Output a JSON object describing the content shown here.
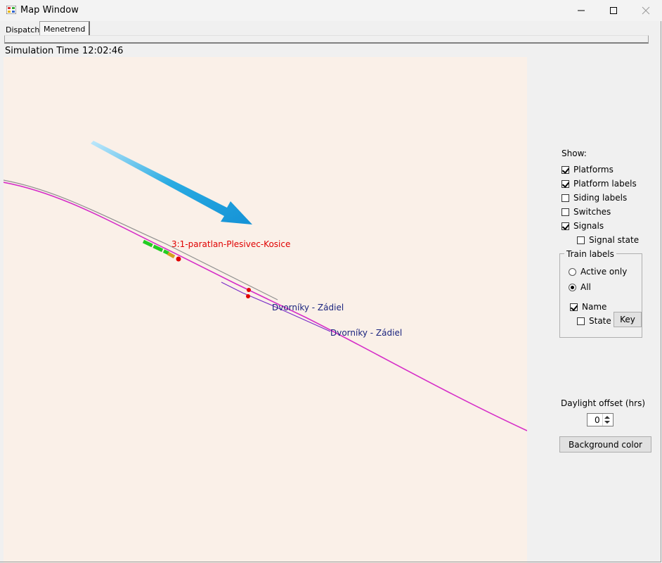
{
  "window": {
    "title": "Map Window",
    "icon": "app-window-icon",
    "controls": [
      "minimize-icon",
      "maximize-icon",
      "close-icon"
    ]
  },
  "tabs": [
    {
      "label": "Dispatch",
      "selected": false
    },
    {
      "label": "Menetrend",
      "selected": true
    }
  ],
  "simulation": {
    "label": "Simulation Time",
    "time": "12:02:46"
  },
  "map": {
    "background_color": "#faf0e8",
    "track_colors": {
      "main": "#d62ec8",
      "secondary": "#909090",
      "platform": "#22cc22",
      "signal": "#e00000"
    },
    "labels": [
      {
        "text": "3:1-paratlan-Plesivec-Kosice",
        "color": "#e00000"
      },
      {
        "text": "Dvorníky - Zádiel",
        "color": "#1a237e"
      },
      {
        "text": "Dvorníky - Zádiel",
        "color": "#1a237e"
      }
    ],
    "annotation_arrow_color": "#1aa3e0"
  },
  "show": {
    "title": "Show:",
    "platforms": {
      "label": "Platforms",
      "checked": true
    },
    "platform_labels": {
      "label": "Platform labels",
      "checked": true
    },
    "siding_labels": {
      "label": "Siding labels",
      "checked": false
    },
    "switches": {
      "label": "Switches",
      "checked": false
    },
    "signals": {
      "label": "Signals",
      "checked": true
    },
    "signal_state": {
      "label": "Signal state",
      "checked": false
    }
  },
  "train_labels": {
    "title": "Train labels",
    "active_only": {
      "label": "Active only",
      "selected": false
    },
    "all": {
      "label": "All",
      "selected": true
    },
    "name": {
      "label": "Name",
      "checked": true
    },
    "state": {
      "label": "State",
      "checked": false
    },
    "key_button": "Key"
  },
  "daylight": {
    "label": "Daylight offset (hrs)",
    "value": "0"
  },
  "background_button": "Background color"
}
